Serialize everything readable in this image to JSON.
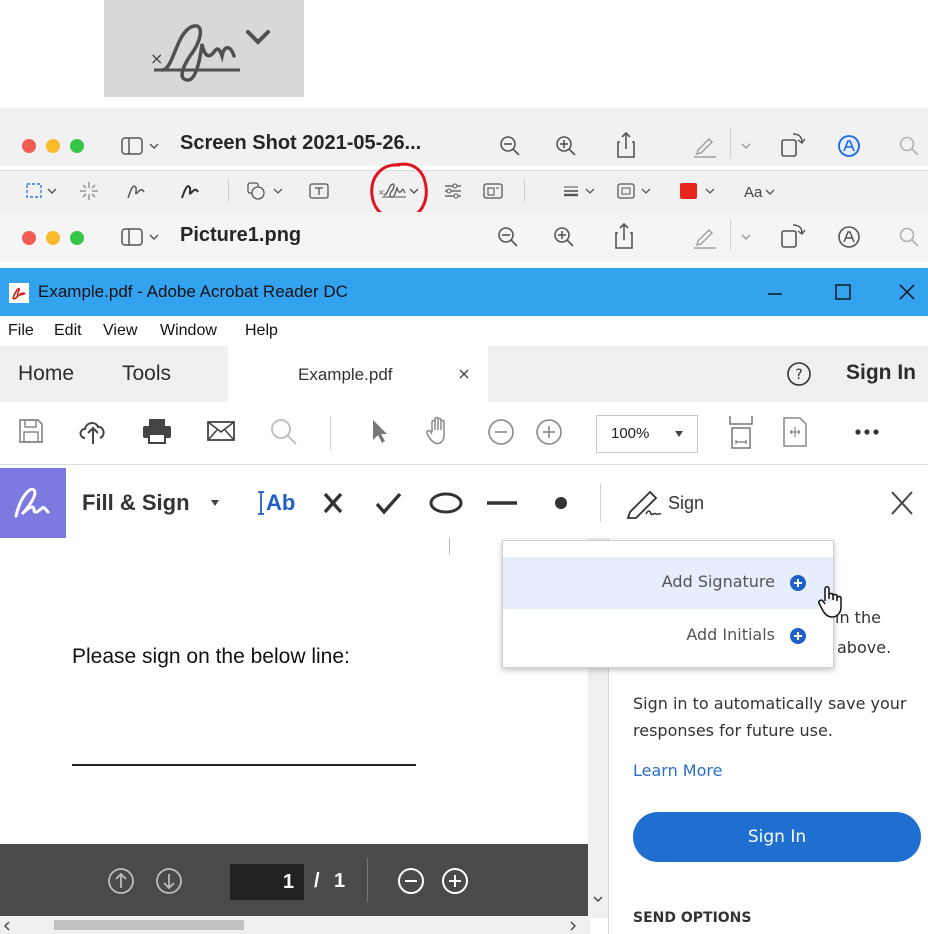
{
  "mac_windows": [
    {
      "title": "Screen Shot 2021-05-26..."
    },
    {
      "title": "Picture1.png"
    }
  ],
  "markup_toolbar": {
    "text_style_label": "Aa",
    "color_swatch": "#e8261c",
    "highlight_color": "#e0141e"
  },
  "acrobat": {
    "window_title": "Example.pdf - Adobe Acrobat Reader DC",
    "title_bar_color": "#33a2ef",
    "menu": [
      "File",
      "Edit",
      "View",
      "Window",
      "Help"
    ],
    "tabs": {
      "home": "Home",
      "tools": "Tools",
      "document": "Example.pdf",
      "sign_in": "Sign In"
    },
    "zoom": "100%",
    "fill_sign": {
      "label": "Fill & Sign",
      "text_tool": "Ab",
      "sign_label": "Sign",
      "accent": "#7c7ae0"
    },
    "dropdown": {
      "add_signature": "Add Signature",
      "add_initials": "Add Initials"
    },
    "document": {
      "instruction": "Please sign on the below line:"
    },
    "panel": {
      "partial_1": "in the",
      "partial_2": "above.",
      "message": "Sign in to automatically save your responses for future use.",
      "learn_more": "Learn More",
      "sign_in_button": "Sign In",
      "send_options": "SEND OPTIONS",
      "button_color": "#1e6fd0"
    },
    "page_nav": {
      "current_page": "1",
      "separator": "/",
      "total_pages": "1"
    }
  }
}
